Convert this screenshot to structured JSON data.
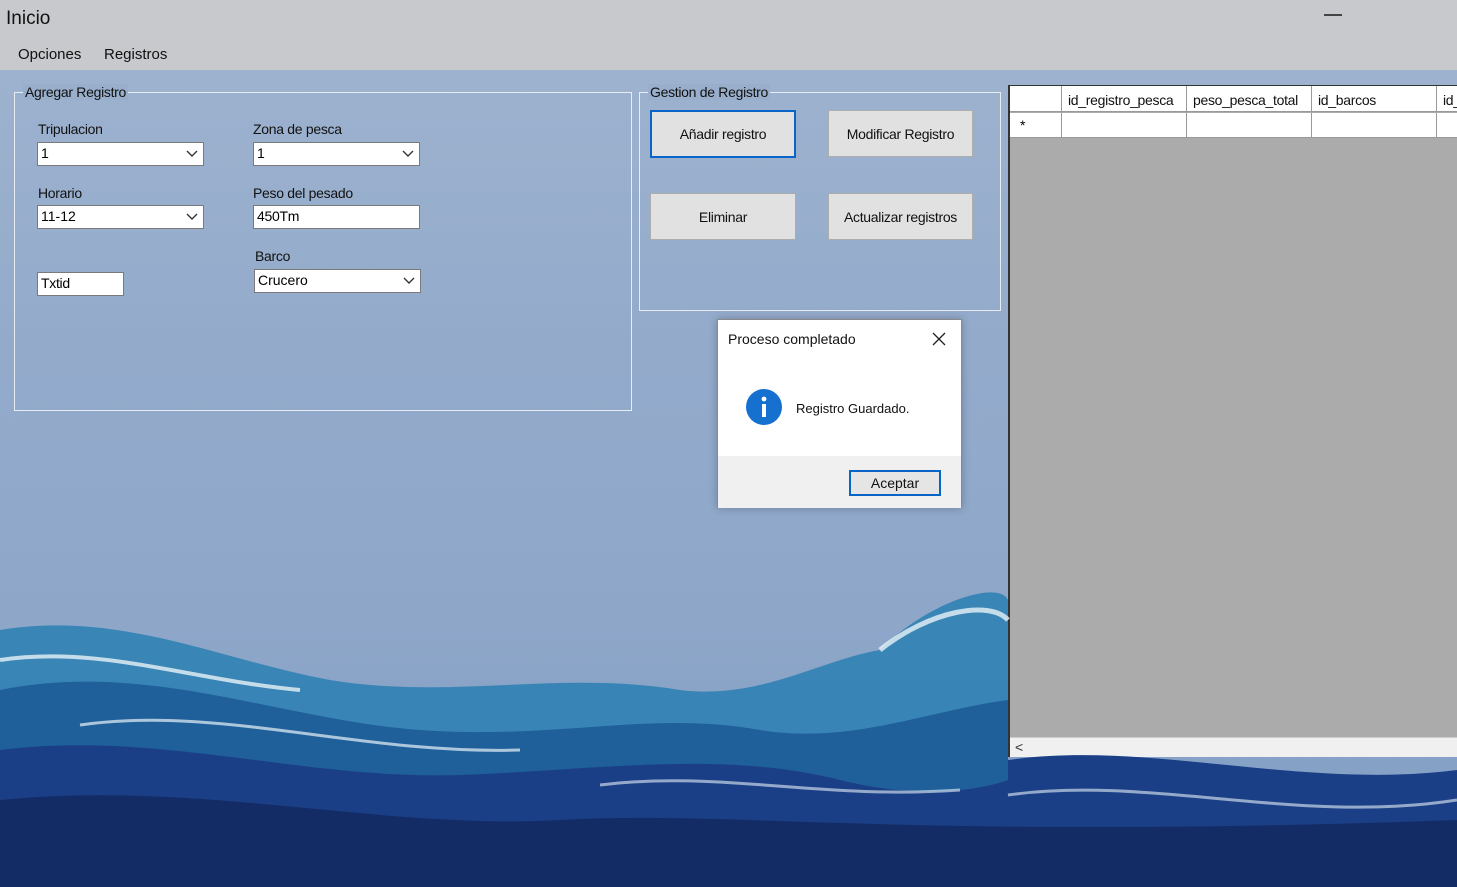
{
  "window": {
    "title": "Inicio"
  },
  "menu": {
    "items": [
      "Opciones",
      "Registros"
    ]
  },
  "agregar": {
    "legend": "Agregar Registro",
    "tripulacion": {
      "label": "Tripulacion",
      "value": "1"
    },
    "zona": {
      "label": "Zona de pesca",
      "value": "1"
    },
    "horario": {
      "label": "Horario",
      "value": "11-12"
    },
    "peso": {
      "label": "Peso del pesado",
      "value": "450Tm"
    },
    "barco": {
      "label": "Barco",
      "value": "Crucero"
    },
    "txtid": {
      "value": "Txtid"
    }
  },
  "gestion": {
    "legend": "Gestion de Registro",
    "add_label": "Añadir registro",
    "modify_label": "Modificar Registro",
    "delete_label": "Eliminar",
    "refresh_label": "Actualizar registros"
  },
  "grid": {
    "columns": [
      "id_registro_pesca",
      "peso_pesca_total",
      "id_barcos",
      "id_"
    ],
    "new_row_marker": "*",
    "scroll_left": "<"
  },
  "dialog": {
    "title": "Proceso completado",
    "message": "Registro Guardado.",
    "ok_label": "Aceptar"
  },
  "colors": {
    "accent": "#0a64c8",
    "info": "#1570d0"
  }
}
